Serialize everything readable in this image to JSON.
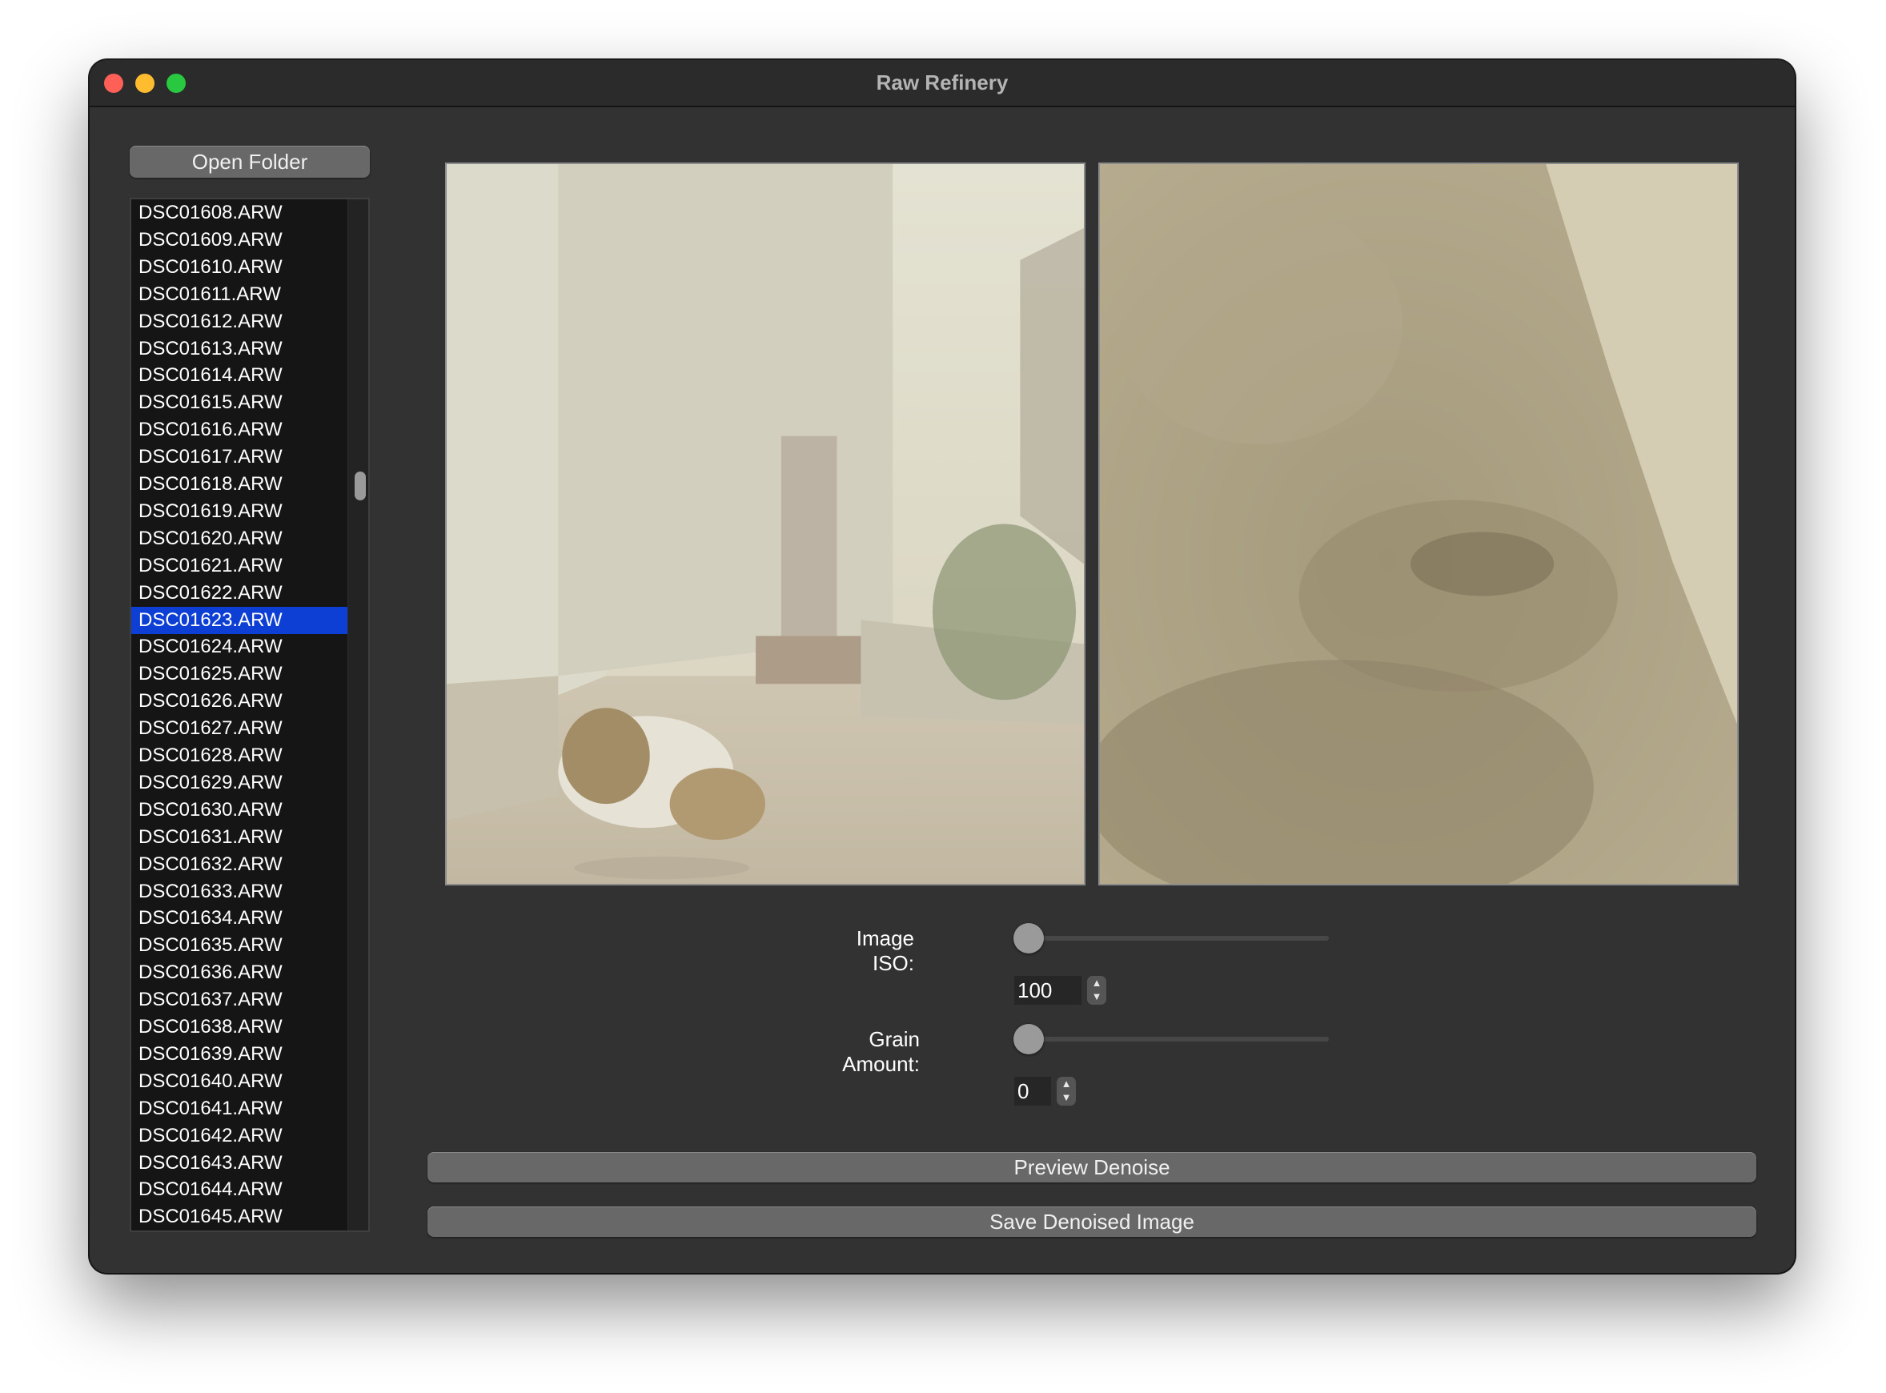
{
  "window": {
    "title": "Raw Refinery"
  },
  "sidebar": {
    "open_folder_label": "Open Folder",
    "files": [
      "DSC01608.ARW",
      "DSC01609.ARW",
      "DSC01610.ARW",
      "DSC01611.ARW",
      "DSC01612.ARW",
      "DSC01613.ARW",
      "DSC01614.ARW",
      "DSC01615.ARW",
      "DSC01616.ARW",
      "DSC01617.ARW",
      "DSC01618.ARW",
      "DSC01619.ARW",
      "DSC01620.ARW",
      "DSC01621.ARW",
      "DSC01622.ARW",
      "DSC01623.ARW",
      "DSC01624.ARW",
      "DSC01625.ARW",
      "DSC01626.ARW",
      "DSC01627.ARW",
      "DSC01628.ARW",
      "DSC01629.ARW",
      "DSC01630.ARW",
      "DSC01631.ARW",
      "DSC01632.ARW",
      "DSC01633.ARW",
      "DSC01634.ARW",
      "DSC01635.ARW",
      "DSC01636.ARW",
      "DSC01637.ARW",
      "DSC01638.ARW",
      "DSC01639.ARW",
      "DSC01640.ARW",
      "DSC01641.ARW",
      "DSC01642.ARW",
      "DSC01643.ARW",
      "DSC01644.ARW",
      "DSC01645.ARW"
    ],
    "selected_file": "DSC01623.ARW",
    "selection_color": "#0e3fd4"
  },
  "controls": {
    "iso_label": "Image ISO:",
    "iso_value": "100",
    "iso_slider_fraction": 0,
    "grain_label": "Grain Amount:",
    "grain_value": "0",
    "grain_slider_fraction": 0
  },
  "actions": {
    "preview_label": "Preview Denoise",
    "save_label": "Save Denoised Image"
  },
  "colors": {
    "window_bg": "#323232",
    "button_bg": "#686868",
    "close": "#fe5f57",
    "minimize": "#febc2e",
    "maximize": "#28c840"
  }
}
